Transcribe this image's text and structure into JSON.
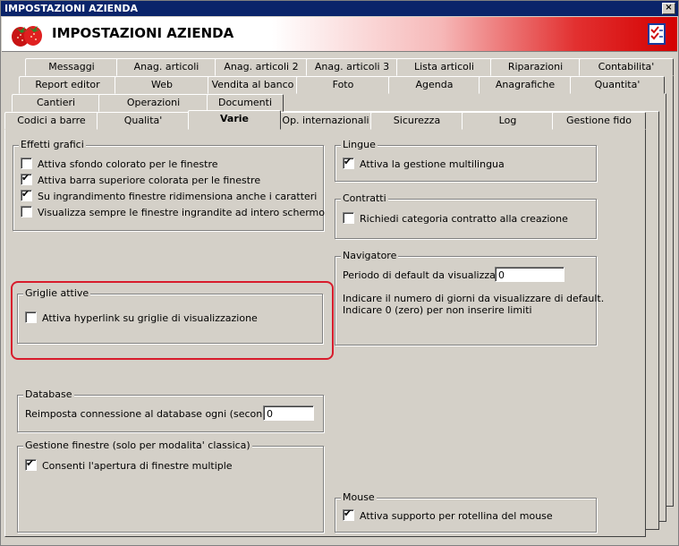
{
  "window": {
    "title": "IMPOSTAZIONI AZIENDA",
    "close_label": "×"
  },
  "header": {
    "title": "IMPOSTAZIONI AZIENDA",
    "logo_icon": "strawberry-logo-icon",
    "right_icon": "checklist-icon"
  },
  "tabs": {
    "row1": [
      "Messaggi",
      "Anag. articoli",
      "Anag. articoli 2",
      "Anag. articoli 3",
      "Lista articoli",
      "Riparazioni",
      "Contabilita'"
    ],
    "row2": [
      "Report editor",
      "Web",
      "Vendita al banco",
      "Foto",
      "Agenda",
      "Anagrafiche",
      "Quantita'"
    ],
    "row3": [
      "Cantieri",
      "Operazioni",
      "Documenti"
    ],
    "row4": [
      "Codici a barre",
      "Qualita'",
      "Varie",
      "Op. internazionali",
      "Sicurezza",
      "Log",
      "Gestione fido"
    ],
    "selected": "Varie"
  },
  "effetti": {
    "legend": "Effetti grafici",
    "items": [
      {
        "label": "Attiva sfondo colorato per le finestre",
        "checked": false
      },
      {
        "label": "Attiva barra superiore colorata per le finestre",
        "checked": true
      },
      {
        "label": "Su ingrandimento finestre ridimensiona anche i caratteri",
        "checked": true
      },
      {
        "label": "Visualizza sempre le finestre ingrandite ad intero schermo",
        "checked": false
      }
    ]
  },
  "griglie": {
    "legend": "Griglie attive",
    "item": {
      "label": "Attiva hyperlink su griglie di visualizzazione",
      "checked": false
    }
  },
  "database": {
    "legend": "Database",
    "label": "Reimposta connessione al database ogni (secondi) :",
    "value": "0"
  },
  "gestione": {
    "legend": "Gestione finestre (solo per modalita' classica)",
    "item": {
      "label": "Consenti l'apertura di finestre multiple",
      "checked": true
    }
  },
  "lingue": {
    "legend": "Lingue",
    "item": {
      "label": "Attiva la gestione multilingua",
      "checked": true
    }
  },
  "contratti": {
    "legend": "Contratti",
    "item": {
      "label": "Richiedi categoria contratto alla creazione",
      "checked": false
    }
  },
  "navigatore": {
    "legend": "Navigatore",
    "label": "Periodo di default da visualizzare :",
    "value": "0",
    "note1": "Indicare il numero di giorni da visualizzare di default.",
    "note2": "Indicare 0 (zero) per non inserire limiti"
  },
  "mouse": {
    "legend": "Mouse",
    "item": {
      "label": "Attiva supporto per rotellina del mouse",
      "checked": true
    }
  },
  "colors": {
    "highlight": "#d81c2c",
    "titlebar": "#0a246a"
  }
}
